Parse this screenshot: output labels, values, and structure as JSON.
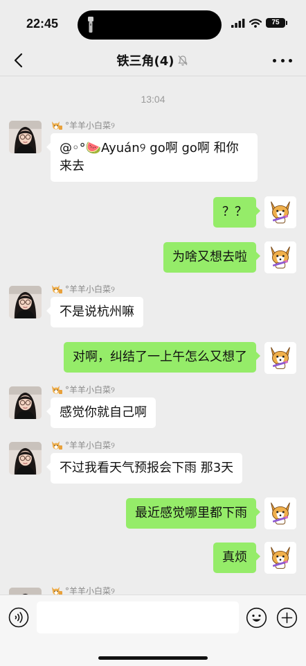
{
  "status_bar": {
    "time": "22:45",
    "battery": "75"
  },
  "nav": {
    "title": "铁三角(4)",
    "back_icon": "chevron-left-icon",
    "mute_icon": "bell-muted-icon",
    "more_icon": "more-dots-icon"
  },
  "chat": {
    "timestamp": "13:04",
    "messages": [
      {
        "side": "left",
        "sender": "°羊羊小白菜୨",
        "text_line1": "@◦°🍉Ayuán୨ go啊 go啊  和你",
        "text_line2": "来去"
      },
      {
        "side": "right",
        "text": "？？"
      },
      {
        "side": "right",
        "text": "为啥又想去啦"
      },
      {
        "side": "left",
        "sender": "°羊羊小白菜୨",
        "text": "不是说杭州嘛"
      },
      {
        "side": "right",
        "text": "对啊，纠结了一上午怎么又想了"
      },
      {
        "side": "left",
        "sender": "°羊羊小白菜୨",
        "text": "感觉你就自己啊"
      },
      {
        "side": "left",
        "sender": "°羊羊小白菜୨",
        "text": "不过我看天气预报会下雨 那3天"
      },
      {
        "side": "right",
        "text": "最近感觉哪里都下雨"
      },
      {
        "side": "right",
        "text": "真烦"
      },
      {
        "side": "left",
        "sender": "°羊羊小白菜୨"
      }
    ]
  },
  "input_bar": {
    "voice_icon": "voice-icon",
    "emoji_icon": "emoji-icon",
    "plus_icon": "plus-circle-icon",
    "input_value": ""
  }
}
